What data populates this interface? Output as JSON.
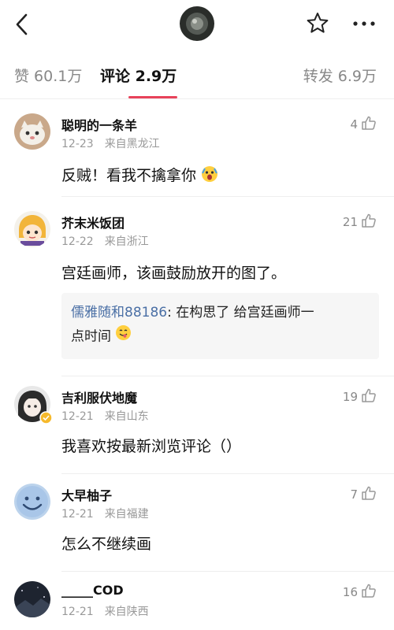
{
  "tabs": [
    {
      "label": "赞 60.1万"
    },
    {
      "label": "评论 2.9万"
    },
    {
      "label": "转发 6.9万"
    }
  ],
  "comments": [
    {
      "username": "聪明的一条羊",
      "date": "12-23",
      "location": "来自黑龙江",
      "likes": "4",
      "text": "反贼！看我不擒拿你"
    },
    {
      "username": "芥末米饭团",
      "date": "12-22",
      "location": "来自浙江",
      "likes": "21",
      "text": "宫廷画师，该画鼓励放开的图了。",
      "reply": {
        "author": "儒雅随和88186",
        "text": ": 在构思了 给宫廷画师一",
        "text2": "点时间"
      }
    },
    {
      "username": "吉利服伏地魔",
      "date": "12-21",
      "location": "来自山东",
      "likes": "19",
      "text": "我喜欢按最新浏览评论（）"
    },
    {
      "username": "大早柚子",
      "date": "12-21",
      "location": "来自福建",
      "likes": "7",
      "text": "怎么不继续画"
    },
    {
      "username": "_____COD",
      "date": "12-21",
      "location": "来自陕西",
      "likes": "16"
    }
  ],
  "colors": {
    "accent": "#e8425a",
    "link": "#4a6fa5"
  }
}
